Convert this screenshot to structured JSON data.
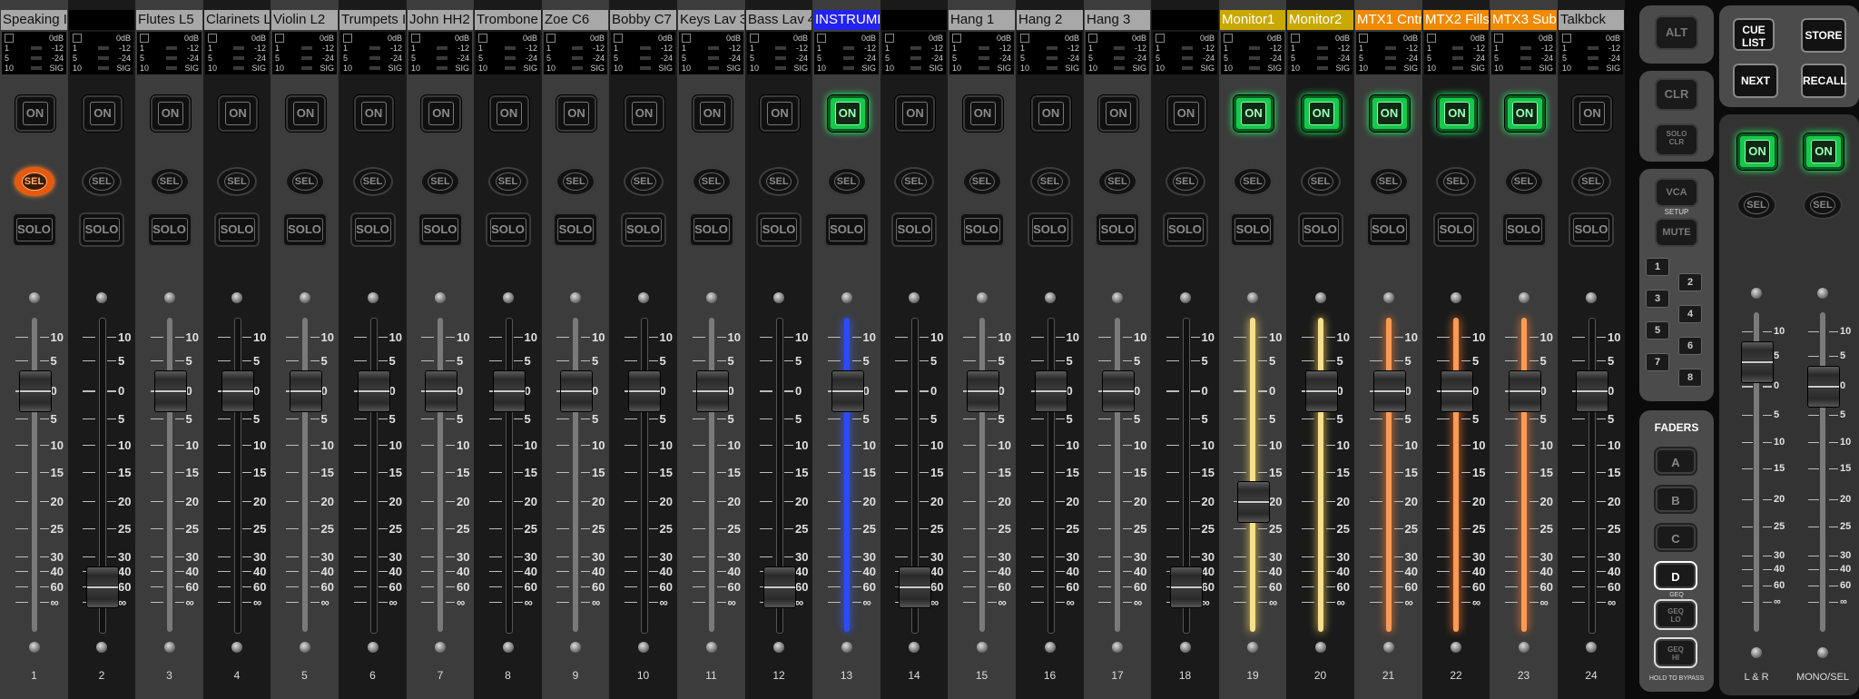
{
  "channels": [
    {
      "name": "Speaking I",
      "number": "1",
      "name_bg": "#a8a8a8",
      "name_fg": "#111111",
      "on": false,
      "sel": true,
      "fader": 0
    },
    {
      "name": "",
      "number": "2",
      "name_bg": "#000000",
      "name_fg": "#dddddd",
      "on": false,
      "sel": false,
      "fader": -60
    },
    {
      "name": "Flutes L5",
      "number": "3",
      "name_bg": "#a8a8a8",
      "name_fg": "#111111",
      "on": false,
      "sel": false,
      "fader": 0
    },
    {
      "name": "Clarinets L",
      "number": "4",
      "name_bg": "#a8a8a8",
      "name_fg": "#111111",
      "on": false,
      "sel": false,
      "fader": 0
    },
    {
      "name": "Violin L2",
      "number": "5",
      "name_bg": "#a8a8a8",
      "name_fg": "#111111",
      "on": false,
      "sel": false,
      "fader": 0
    },
    {
      "name": "Trumpets I",
      "number": "6",
      "name_bg": "#a8a8a8",
      "name_fg": "#111111",
      "on": false,
      "sel": false,
      "fader": 0
    },
    {
      "name": "John HH2",
      "number": "7",
      "name_bg": "#a8a8a8",
      "name_fg": "#111111",
      "on": false,
      "sel": false,
      "fader": 0
    },
    {
      "name": "Trombone",
      "number": "8",
      "name_bg": "#a8a8a8",
      "name_fg": "#111111",
      "on": false,
      "sel": false,
      "fader": 0
    },
    {
      "name": "Zoe C6",
      "number": "9",
      "name_bg": "#a8a8a8",
      "name_fg": "#111111",
      "on": false,
      "sel": false,
      "fader": 0
    },
    {
      "name": "Bobby C7",
      "number": "10",
      "name_bg": "#a8a8a8",
      "name_fg": "#111111",
      "on": false,
      "sel": false,
      "fader": 0
    },
    {
      "name": "Keys Lav 3",
      "number": "11",
      "name_bg": "#a8a8a8",
      "name_fg": "#111111",
      "on": false,
      "sel": false,
      "fader": 0
    },
    {
      "name": "Bass Lav 4",
      "number": "12",
      "name_bg": "#a8a8a8",
      "name_fg": "#111111",
      "on": false,
      "sel": false,
      "fader": -60
    },
    {
      "name": "INSTRUME",
      "number": "13",
      "name_bg": "#2222ee",
      "name_fg": "#ffffff",
      "on": true,
      "sel": false,
      "fader": 0
    },
    {
      "name": "",
      "number": "14",
      "name_bg": "#000000",
      "name_fg": "#dddddd",
      "on": false,
      "sel": false,
      "fader": -60
    },
    {
      "name": "Hang 1",
      "number": "15",
      "name_bg": "#a8a8a8",
      "name_fg": "#111111",
      "on": false,
      "sel": false,
      "fader": 0
    },
    {
      "name": "Hang 2",
      "number": "16",
      "name_bg": "#a8a8a8",
      "name_fg": "#111111",
      "on": false,
      "sel": false,
      "fader": 0
    },
    {
      "name": "Hang 3",
      "number": "17",
      "name_bg": "#a8a8a8",
      "name_fg": "#111111",
      "on": false,
      "sel": false,
      "fader": 0
    },
    {
      "name": "",
      "number": "18",
      "name_bg": "#000000",
      "name_fg": "#dddddd",
      "on": false,
      "sel": false,
      "fader": -60
    },
    {
      "name": "Monitor1",
      "number": "19",
      "name_bg": "#c9a800",
      "name_fg": "#ffffff",
      "on": true,
      "sel": false,
      "fader": -20
    },
    {
      "name": "Monitor2",
      "number": "20",
      "name_bg": "#c9a800",
      "name_fg": "#ffffff",
      "on": true,
      "sel": false,
      "fader": 0
    },
    {
      "name": "MTX1 Cntr",
      "number": "21",
      "name_bg": "#f08a00",
      "name_fg": "#ffffff",
      "on": true,
      "sel": false,
      "fader": 0
    },
    {
      "name": "MTX2 Fills",
      "number": "22",
      "name_bg": "#f08a00",
      "name_fg": "#ffffff",
      "on": true,
      "sel": false,
      "fader": 0
    },
    {
      "name": "MTX3 Sub",
      "number": "23",
      "name_bg": "#f08a00",
      "name_fg": "#ffffff",
      "on": true,
      "sel": false,
      "fader": 0
    },
    {
      "name": "Talkbck",
      "number": "24",
      "name_bg": "#a8a8a8",
      "name_fg": "#111111",
      "on": false,
      "sel": false,
      "fader": 0
    }
  ],
  "labels": {
    "on": "ON",
    "sel": "SEL",
    "solo": "SOLO"
  },
  "meter_labels": {
    "db": "0dB",
    "r1a": "1",
    "r1b": "-12",
    "r2a": "5",
    "r2b": "-24",
    "r3a": "10",
    "r3b": "SIG"
  },
  "scale": [
    "10",
    "5",
    "0",
    "5",
    "10",
    "15",
    "20",
    "25",
    "30",
    "40",
    "60",
    "∞"
  ],
  "side": {
    "alt": "ALT",
    "clr": "CLR",
    "solo_clr_1": "SOLO",
    "solo_clr_2": "CLR",
    "vca": "VCA",
    "setup": "SETUP",
    "mute": "MUTE",
    "groups": [
      "1",
      "2",
      "3",
      "4",
      "5",
      "6",
      "7",
      "8"
    ],
    "faders_title": "FADERS",
    "layers": [
      "A",
      "B",
      "C",
      "D"
    ],
    "geq_title": "GEQ",
    "geq_1a": "GEQ",
    "geq_1b": "LO",
    "geq_2a": "GEQ",
    "geq_2b": "HI",
    "hold": "HOLD TO BYPASS"
  },
  "right": {
    "cue_list": "CUE LIST",
    "store": "STORE",
    "next": "NEXT",
    "recall": "RECALL",
    "masters": [
      {
        "name": "L & R",
        "on": true
      },
      {
        "name": "MONO/SEL",
        "on": true
      }
    ]
  },
  "colors": {
    "green": "#16c94a",
    "orange": "#e65a10",
    "blue": "#2a4bff"
  }
}
